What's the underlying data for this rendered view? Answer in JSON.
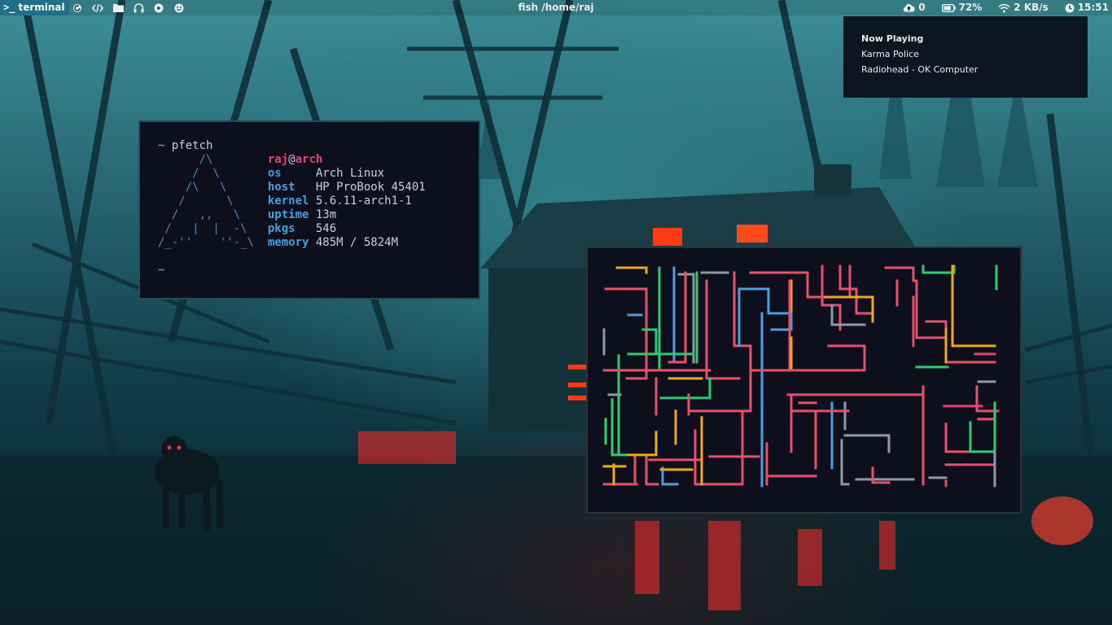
{
  "topbar": {
    "workspace": {
      "prompt_glyph": ">_",
      "label": "terminal"
    },
    "launchers": [
      {
        "name": "restart-icon"
      },
      {
        "name": "code-icon"
      },
      {
        "name": "folder-icon"
      },
      {
        "name": "headphones-icon"
      },
      {
        "name": "play-icon"
      },
      {
        "name": "smiley-icon"
      }
    ],
    "window_title": "fish /home/raj",
    "tray": {
      "cloud_value": "0",
      "battery": "72%",
      "network": "2 KB/s",
      "clock": "15:51"
    }
  },
  "notification": {
    "summary": "Now Playing",
    "track": "Karma Police",
    "artist_album": "Radiohead - OK Computer"
  },
  "pfetch": {
    "command_prompt": "~",
    "command": "pfetch",
    "user": "raj",
    "at": "@",
    "host_name": "arch",
    "fields": [
      {
        "key": "os",
        "value": "Arch Linux"
      },
      {
        "key": "host",
        "value": "HP ProBook 45401"
      },
      {
        "key": "kernel",
        "value": "5.6.11-arch1-1"
      },
      {
        "key": "uptime",
        "value": "13m"
      },
      {
        "key": "pkgs",
        "value": "546"
      },
      {
        "key": "memory",
        "value": "485M / 5824M"
      }
    ],
    "logo_lines": [
      "      /\\",
      "     /  \\",
      "    /\\   \\",
      "   /      \\",
      "  /   ,,   \\",
      " /   |  |  -\\",
      "/_-''    ''-_\\"
    ],
    "next_prompt": "~"
  },
  "colors": {
    "accent": "#1f6f88",
    "terminal_bg": "#0d0f1c",
    "pfetch_key": "#3fa2dd",
    "pfetch_user": "#e8407a",
    "pipe_colors": [
      "#e8506a",
      "#4a9fe0",
      "#2ecc71",
      "#f0a81a",
      "#8e9aa3",
      "#e8407a"
    ]
  }
}
